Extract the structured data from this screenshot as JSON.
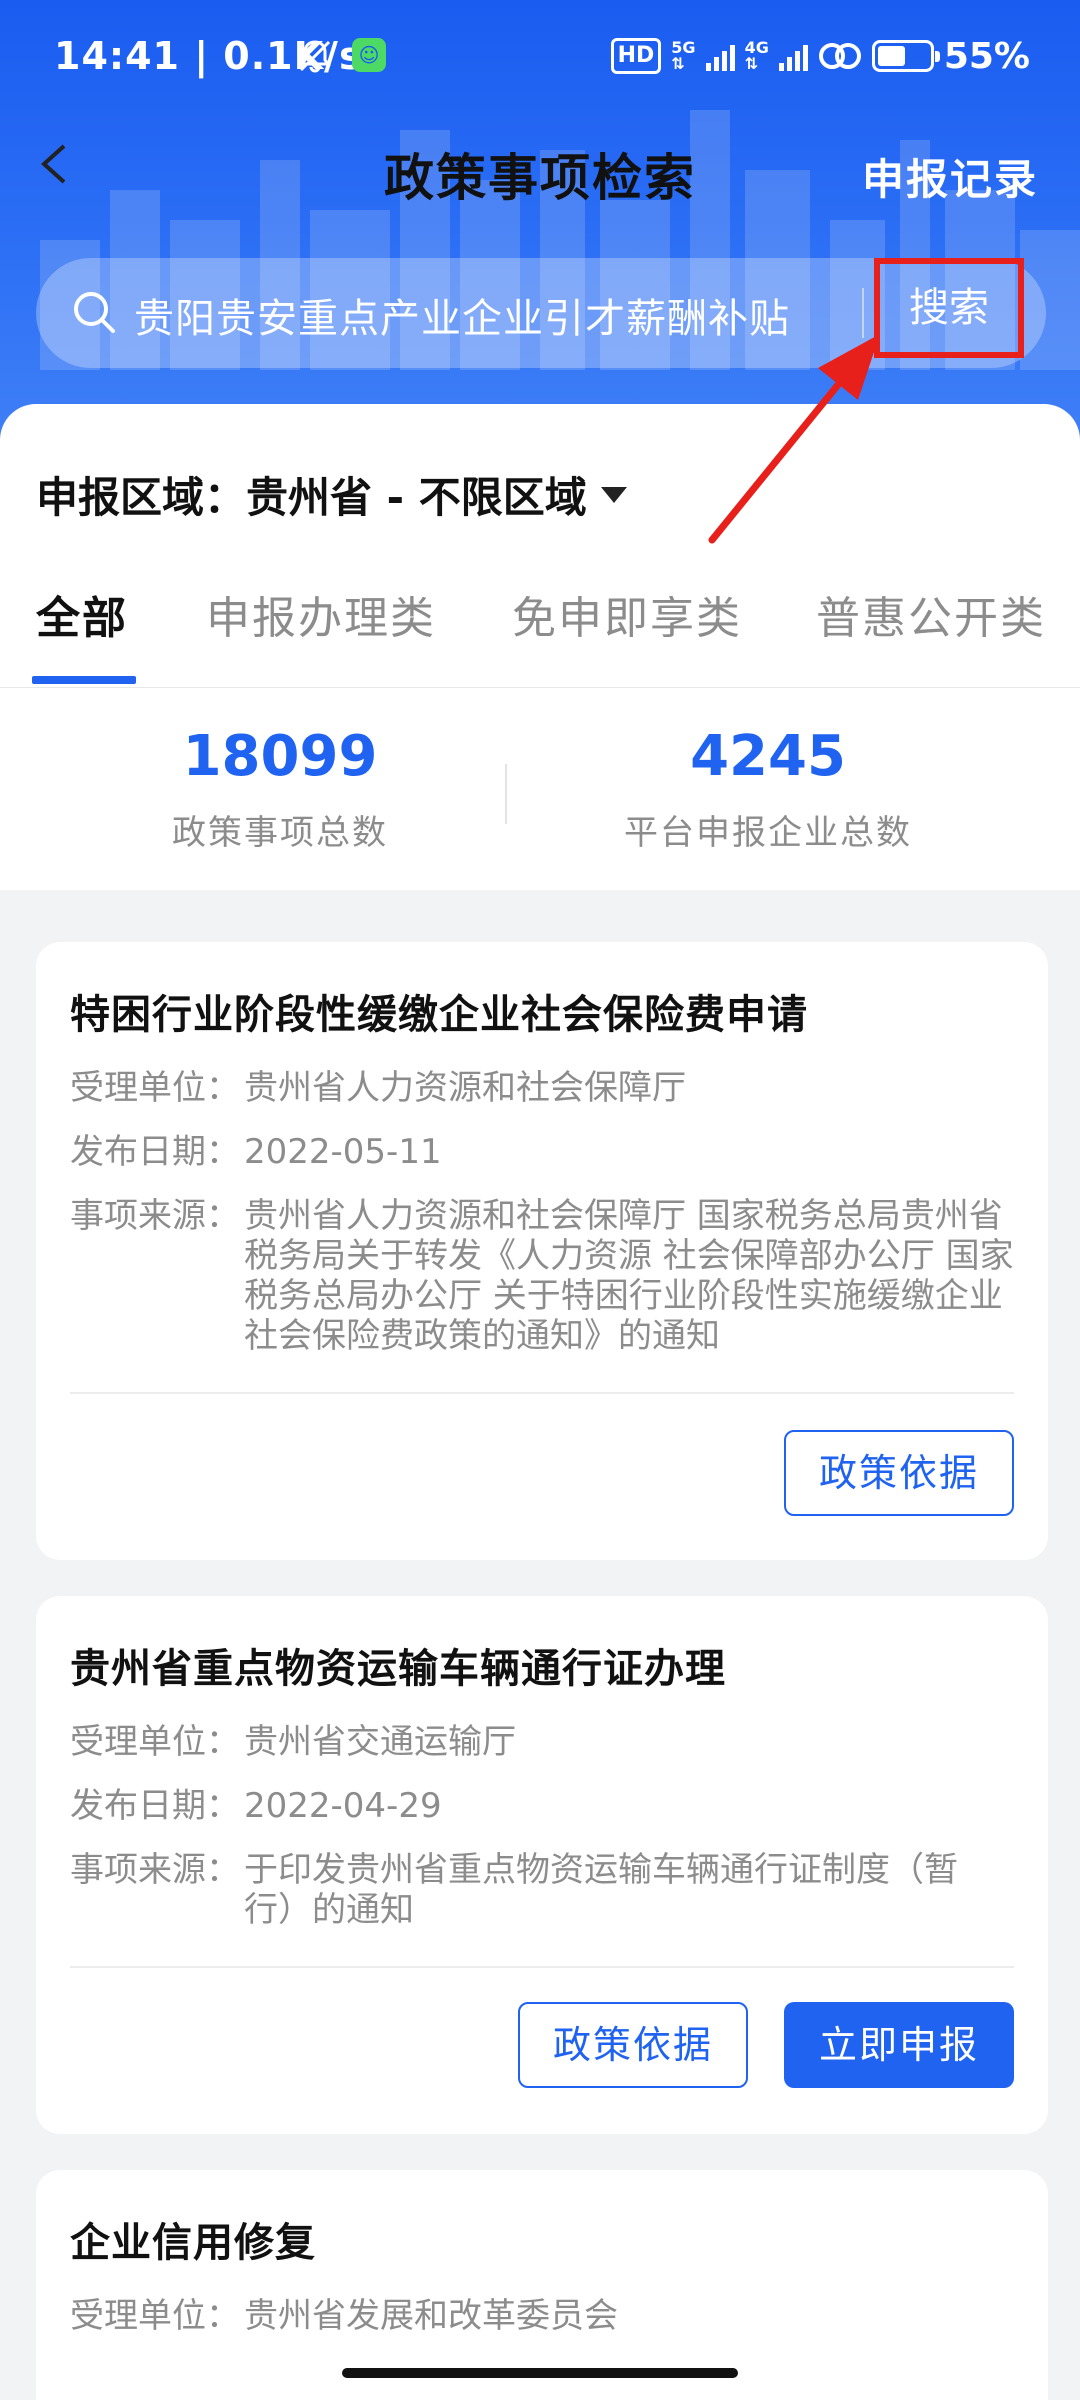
{
  "status_bar": {
    "time": "14:41 | 0.1K/s",
    "hd_badge": "HD",
    "net_1": "5G",
    "net_2": "4G",
    "battery_percent": "55%",
    "battery_level": 0.55
  },
  "header": {
    "title": "政策事项检索",
    "records_link": "申报记录"
  },
  "search": {
    "query": "贵阳贵安重点产业企业引才薪酬补贴",
    "button_label": "搜索"
  },
  "filter": {
    "region_label": "申报区域：",
    "region_value": "贵州省 - 不限区域"
  },
  "tabs": [
    {
      "label": "全部",
      "active": true
    },
    {
      "label": "申报办理类",
      "active": false
    },
    {
      "label": "免申即享类",
      "active": false
    },
    {
      "label": "普惠公开类",
      "active": false
    }
  ],
  "stats": [
    {
      "value": "18099",
      "label": "政策事项总数"
    },
    {
      "value": "4245",
      "label": "平台申报企业总数"
    }
  ],
  "field_labels": {
    "unit": "受理单位：",
    "date": "发布日期：",
    "source": "事项来源："
  },
  "cards": [
    {
      "title": "特困行业阶段性缓缴企业社会保险费申请",
      "unit": "贵州省人力资源和社会保障厅",
      "date": "2022-05-11",
      "source": "贵州省人力资源和社会保障厅 国家税务总局贵州省税务局关于转发《人力资源 社会保障部办公厅 国家税务总局办公厅 关于特困行业阶段性实施缓缴企业 社会保险费政策的通知》的通知",
      "btn_basis": "政策依据"
    },
    {
      "title": "贵州省重点物资运输车辆通行证办理",
      "unit": "贵州省交通运输厅",
      "date": "2022-04-29",
      "source": "于印发贵州省重点物资运输车辆通行证制度（暂行）的通知",
      "btn_basis": "政策依据",
      "btn_apply": "立即申报"
    },
    {
      "title": "企业信用修复",
      "unit": "贵州省发展和改革委员会"
    }
  ],
  "colors": {
    "brand_blue": "#1f63f0",
    "annotation_red": "#e8201b"
  }
}
